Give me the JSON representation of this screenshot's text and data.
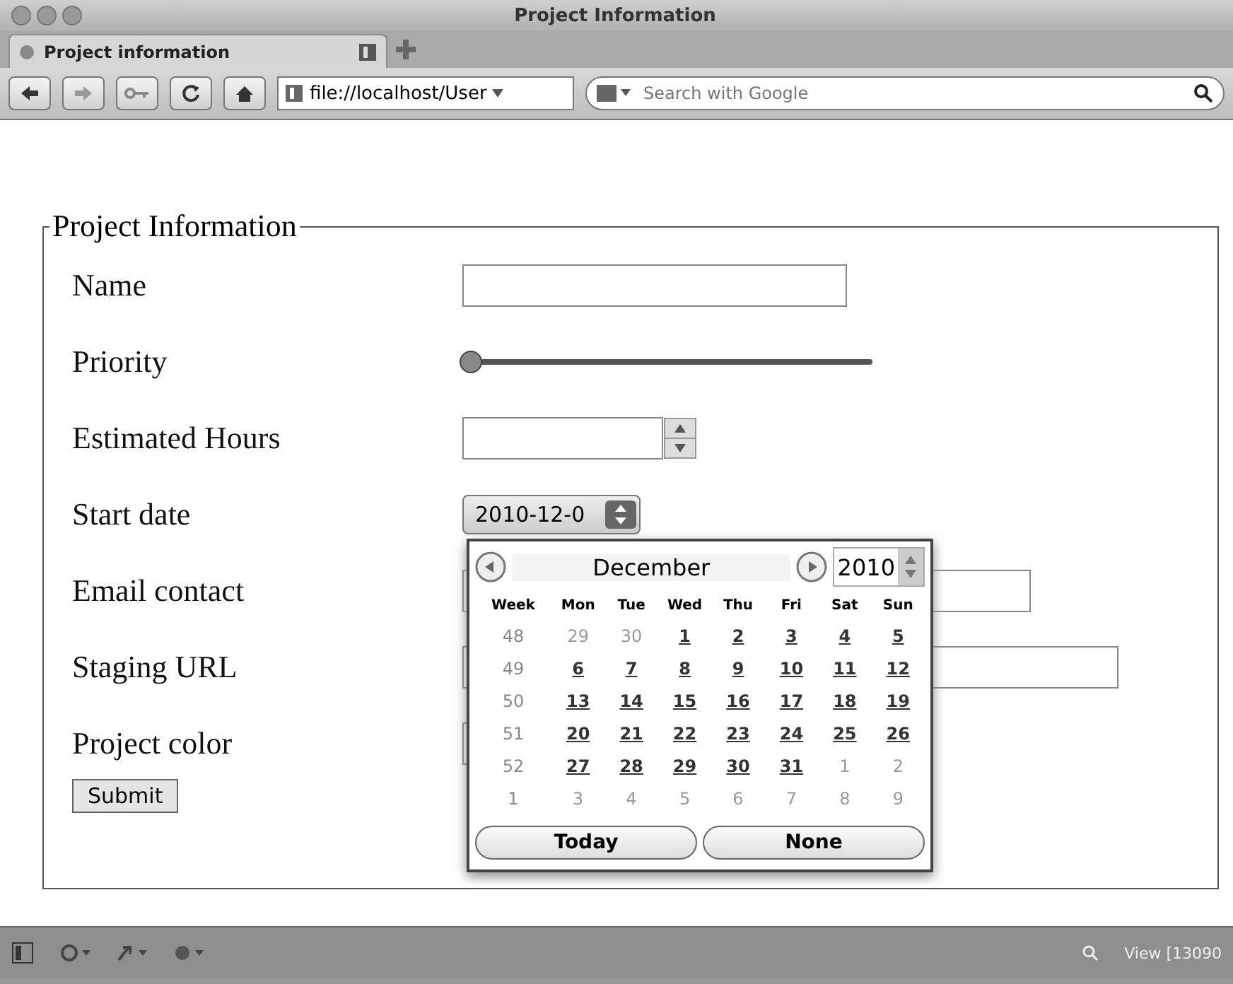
{
  "window": {
    "title": "Project Information"
  },
  "tabs": [
    {
      "label": "Project information",
      "selected": true
    }
  ],
  "toolbar": {
    "address": "file://localhost/User",
    "search_placeholder": "Search with Google"
  },
  "form": {
    "legend": "Project Information",
    "submit": "Submit",
    "fields": [
      {
        "label": "Name",
        "kind": "text"
      },
      {
        "label": "Priority",
        "kind": "range",
        "level": 0
      },
      {
        "label": "Estimated Hours",
        "kind": "number"
      },
      {
        "label": "Start date",
        "kind": "date",
        "value": "2010-12-0"
      },
      {
        "label": "Email contact",
        "kind": "email"
      },
      {
        "label": "Staging URL",
        "kind": "url"
      },
      {
        "label": "Project color",
        "kind": "color"
      }
    ]
  },
  "date_picker": {
    "month": "December",
    "year": "2010",
    "week_heading": "Week",
    "weekdays": [
      "Mon",
      "Tue",
      "Wed",
      "Thu",
      "Fri",
      "Sat",
      "Sun"
    ],
    "weeks": [
      {
        "week": "48",
        "days": [
          {
            "day": "29",
            "in_month": false
          },
          {
            "day": "30",
            "in_month": false
          },
          {
            "day": "1",
            "in_month": true
          },
          {
            "day": "2",
            "in_month": true
          },
          {
            "day": "3",
            "in_month": true
          },
          {
            "day": "4",
            "in_month": true
          },
          {
            "day": "5",
            "in_month": true
          }
        ]
      },
      {
        "week": "49",
        "days": [
          {
            "day": "6",
            "in_month": true
          },
          {
            "day": "7",
            "in_month": true
          },
          {
            "day": "8",
            "in_month": true
          },
          {
            "day": "9",
            "in_month": true
          },
          {
            "day": "10",
            "in_month": true
          },
          {
            "day": "11",
            "in_month": true
          },
          {
            "day": "12",
            "in_month": true
          }
        ]
      },
      {
        "week": "50",
        "days": [
          {
            "day": "13",
            "in_month": true
          },
          {
            "day": "14",
            "in_month": true
          },
          {
            "day": "15",
            "in_month": true
          },
          {
            "day": "16",
            "in_month": true
          },
          {
            "day": "17",
            "in_month": true
          },
          {
            "day": "18",
            "in_month": true
          },
          {
            "day": "19",
            "in_month": true
          }
        ]
      },
      {
        "week": "51",
        "days": [
          {
            "day": "20",
            "in_month": true
          },
          {
            "day": "21",
            "in_month": true
          },
          {
            "day": "22",
            "in_month": true
          },
          {
            "day": "23",
            "in_month": true
          },
          {
            "day": "24",
            "in_month": true
          },
          {
            "day": "25",
            "in_month": true
          },
          {
            "day": "26",
            "in_month": true
          }
        ]
      },
      {
        "week": "52",
        "days": [
          {
            "day": "27",
            "in_month": true
          },
          {
            "day": "28",
            "in_month": true
          },
          {
            "day": "29",
            "in_month": true
          },
          {
            "day": "30",
            "in_month": true
          },
          {
            "day": "31",
            "in_month": true
          },
          {
            "day": "1",
            "in_month": false
          },
          {
            "day": "2",
            "in_month": false
          }
        ]
      },
      {
        "week": "1",
        "days": [
          {
            "day": "3",
            "in_month": false
          },
          {
            "day": "4",
            "in_month": false
          },
          {
            "day": "5",
            "in_month": false
          },
          {
            "day": "6",
            "in_month": false
          },
          {
            "day": "7",
            "in_month": false
          },
          {
            "day": "8",
            "in_month": false
          },
          {
            "day": "9",
            "in_month": false
          }
        ]
      }
    ],
    "buttons": [
      "Today",
      "None"
    ]
  },
  "status_bar": {
    "zoom": "View [13090"
  }
}
